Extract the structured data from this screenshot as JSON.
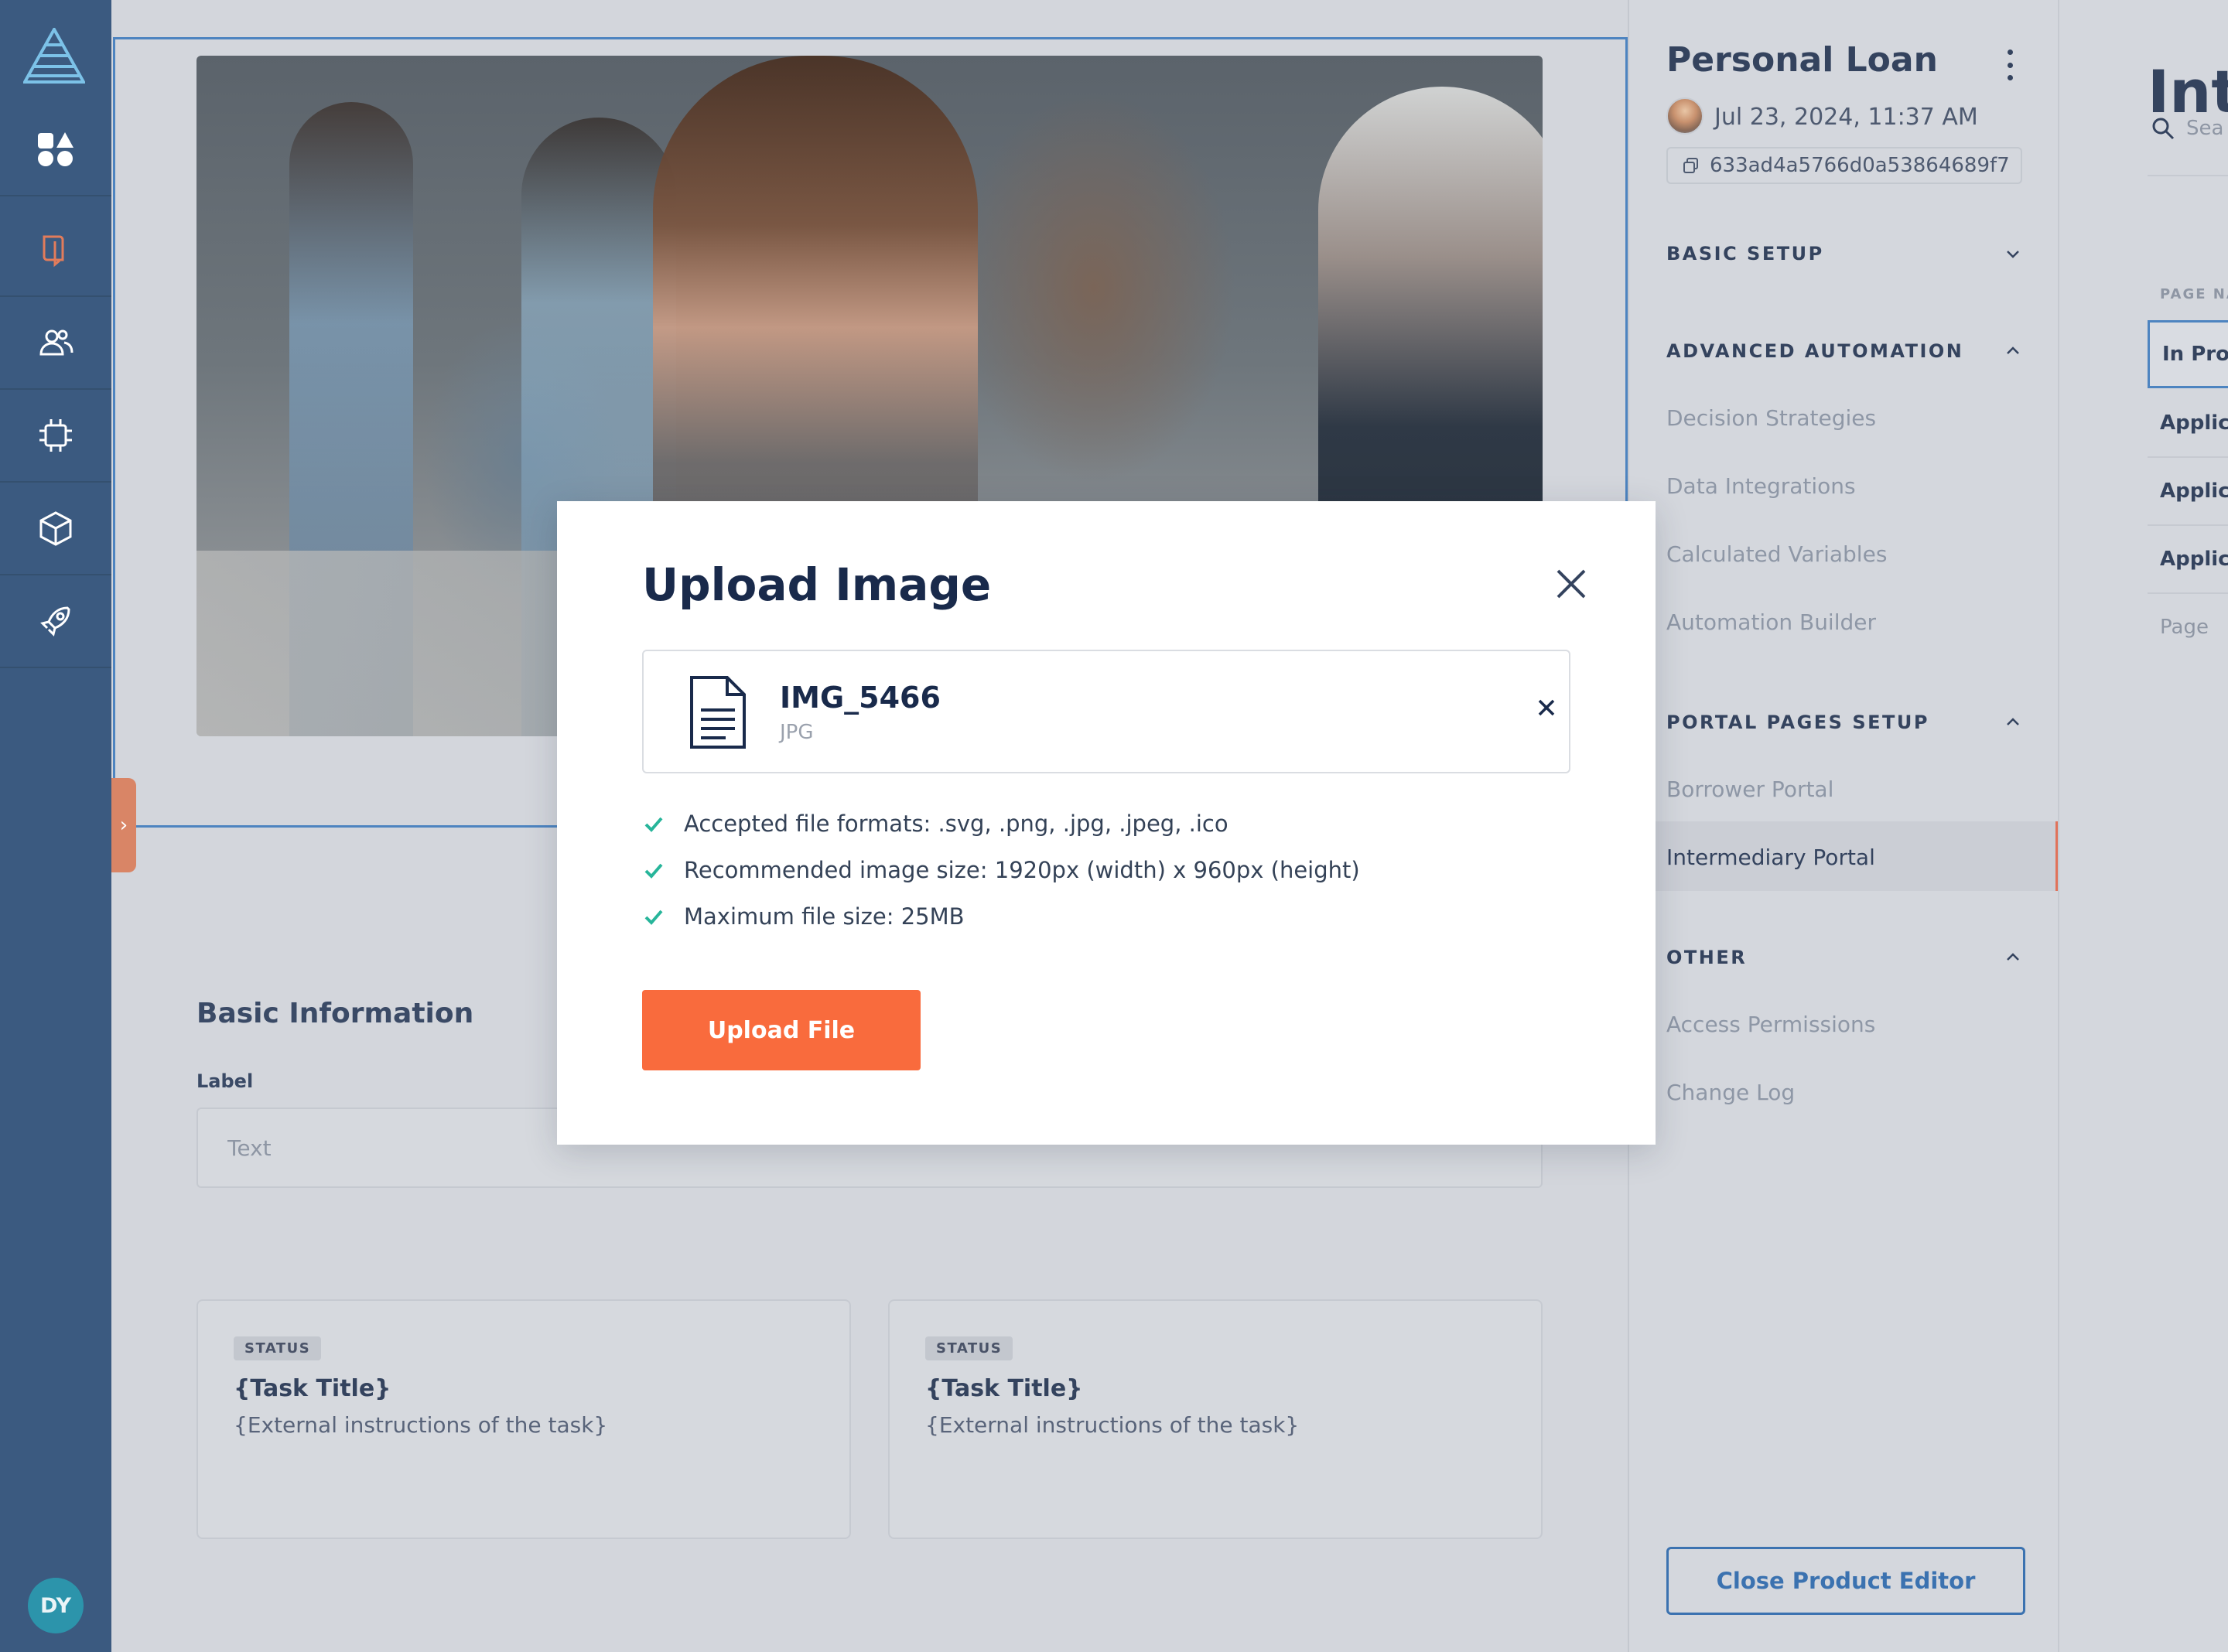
{
  "sidebar": {
    "avatar_initials": "DY",
    "items": [
      {
        "icon": "shapes-icon"
      },
      {
        "icon": "book-open-icon"
      },
      {
        "icon": "users-icon"
      },
      {
        "icon": "chip-icon"
      },
      {
        "icon": "cube-icon"
      },
      {
        "icon": "rocket-icon"
      }
    ]
  },
  "canvas": {
    "section_title": "Basic Information",
    "label_field": {
      "label": "Label",
      "placeholder": "Text"
    },
    "task_cards": [
      {
        "status": "STATUS",
        "title": "{Task Title}",
        "description": "{External instructions of the task}"
      },
      {
        "status": "STATUS",
        "title": "{Task Title}",
        "description": "{External instructions of the task}"
      }
    ]
  },
  "editor": {
    "title": "Personal Loan",
    "date": "Jul 23, 2024, 11:37 AM",
    "id": "633ad4a5766d0a53864689f7",
    "sections": [
      {
        "label": "BASIC SETUP",
        "expanded": false,
        "items": []
      },
      {
        "label": "ADVANCED AUTOMATION",
        "expanded": true,
        "items": [
          "Decision Strategies",
          "Data Integrations",
          "Calculated Variables",
          "Automation Builder"
        ]
      },
      {
        "label": "PORTAL PAGES SETUP",
        "expanded": true,
        "items": [
          "Borrower Portal",
          "Intermediary Portal"
        ]
      },
      {
        "label": "OTHER",
        "expanded": true,
        "items": [
          "Access Permissions",
          "Change Log"
        ]
      }
    ],
    "active_item": "Intermediary Portal",
    "close_button": "Close Product Editor"
  },
  "preview": {
    "title": "Int",
    "search_placeholder": "Sea",
    "column_header": "PAGE NA",
    "rows": [
      "In Prog",
      "Applica",
      "Applica",
      "Applica"
    ],
    "footer": "Page"
  },
  "modal": {
    "title": "Upload Image",
    "file": {
      "name": "IMG_5466",
      "type": "JPG"
    },
    "rules": [
      "Accepted file formats: .svg, .png, .jpg, .jpeg, .ico",
      "Recommended image size: 1920px (width) x 960px (height)",
      "Maximum file size: 25MB"
    ],
    "upload_button": "Upload File"
  },
  "colors": {
    "accent": "#f96b3d",
    "brand_blue": "#3b72b0",
    "rail": "#3b5a80",
    "check": "#27b59a"
  }
}
